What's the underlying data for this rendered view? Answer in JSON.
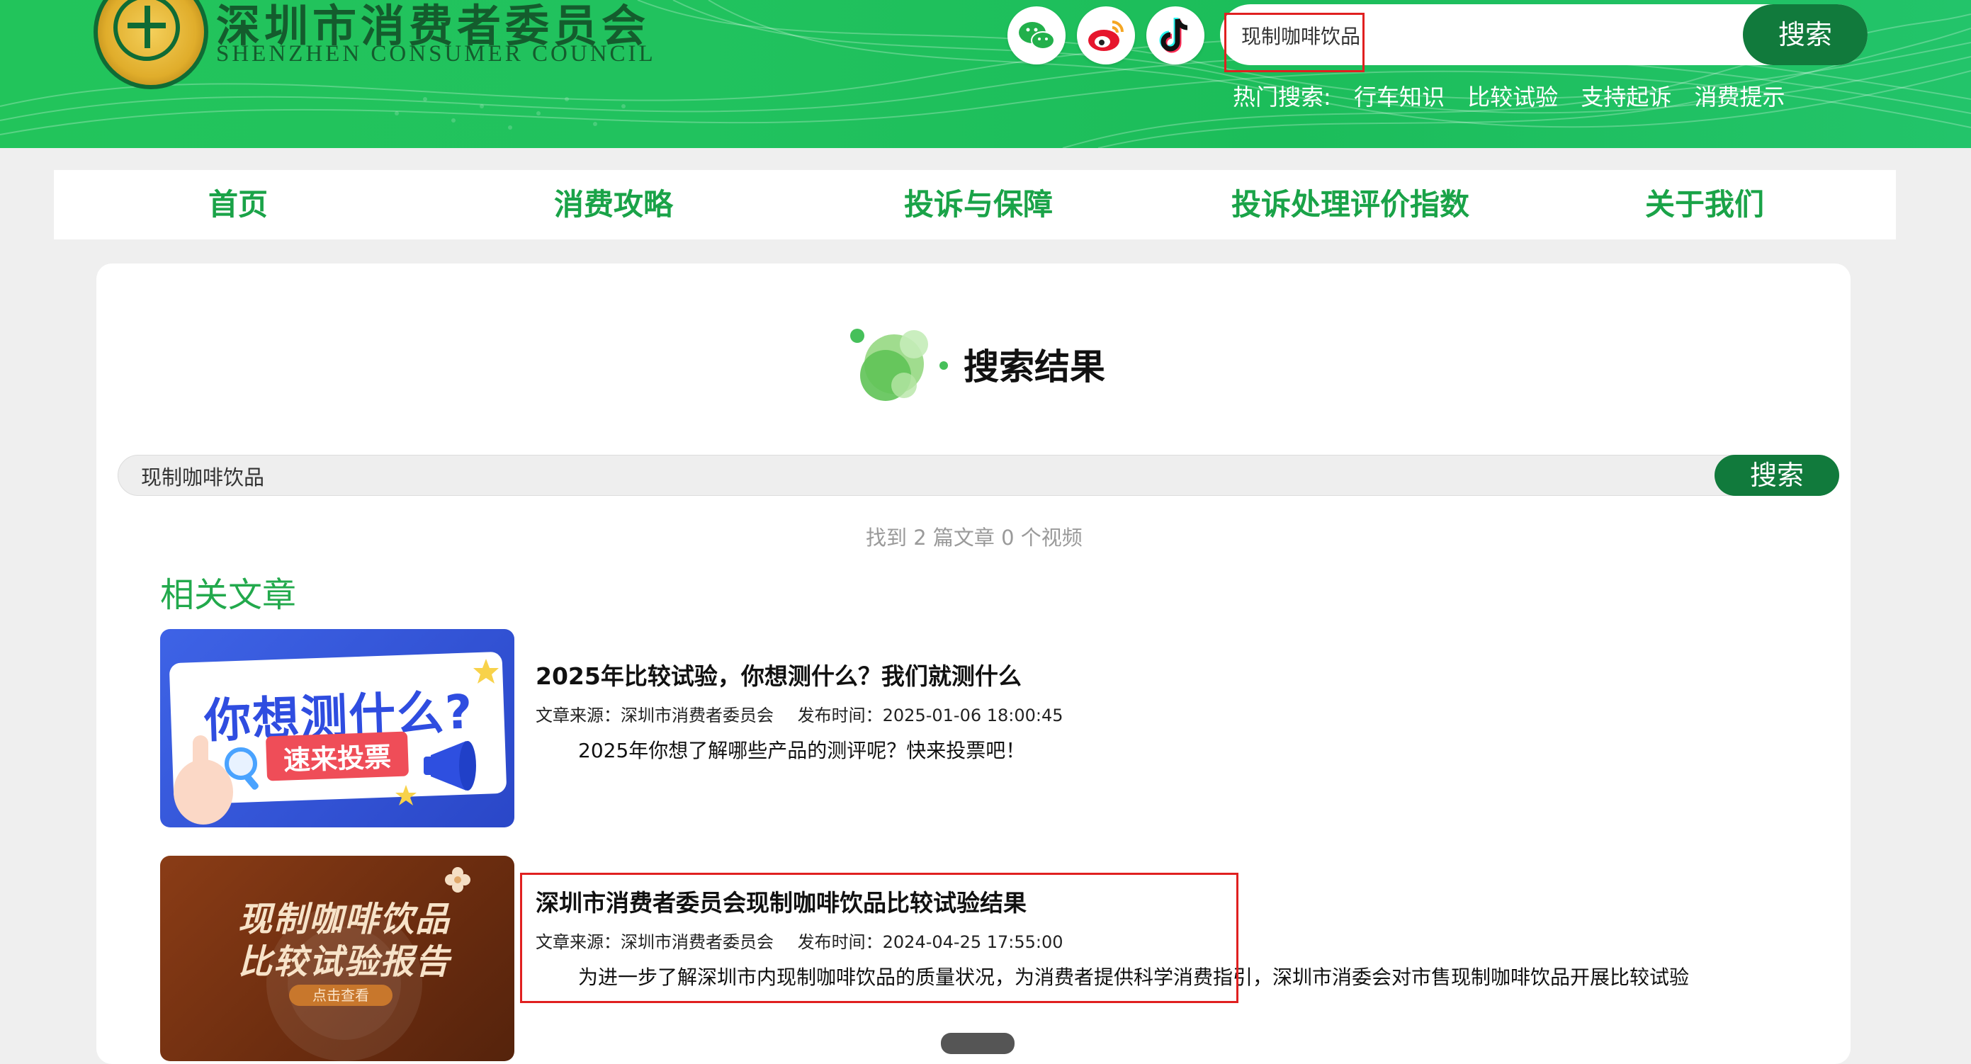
{
  "header": {
    "logo_cn": "深圳市消费者委员会",
    "logo_en": "SHENZHEN CONSUMER COUNCIL",
    "social": [
      "wechat-icon",
      "weibo-icon",
      "tiktok-icon"
    ],
    "search_value": "现制咖啡饮品",
    "search_button": "搜索",
    "hot_label": "热门搜索:",
    "hot_links": [
      "行车知识",
      "比较试验",
      "支持起诉",
      "消费提示"
    ]
  },
  "nav": {
    "items": [
      "首页",
      "消费攻略",
      "投诉与保障",
      "投诉处理评价指数",
      "关于我们"
    ]
  },
  "main": {
    "title": "搜索结果",
    "search_value": "现制咖啡饮品",
    "search_button": "搜索",
    "result_count": "找到 2 篇文章 0 个视频",
    "section_title": "相关文章",
    "articles": [
      {
        "thumb_line1": "你想测什么?",
        "thumb_line2": "速来投票",
        "title": "2025年比较试验，你想测什么？我们就测什么",
        "source": "文章来源：深圳市消费者委员会",
        "time": "发布时间：2025-01-06 18:00:45",
        "desc": "2025年你想了解哪些产品的测评呢？快来投票吧！"
      },
      {
        "thumb_line1": "现制咖啡饮品",
        "thumb_line2": "比较试验报告",
        "thumb_button": "点击查看",
        "title": "深圳市消费者委员会现制咖啡饮品比较试验结果",
        "source": "文章来源：深圳市消费者委员会",
        "time": "发布时间：2024-04-25 17:55:00",
        "desc": "为进一步了解深圳市内现制咖啡饮品的质量状况，为消费者提供科学消费指引，深圳市消委会对市售现制咖啡饮品开展比较试验"
      }
    ]
  },
  "colors": {
    "header_green": "#22c45b",
    "nav_green": "#1aa348",
    "button_green": "#117a3c",
    "highlight_red": "#e02020"
  }
}
